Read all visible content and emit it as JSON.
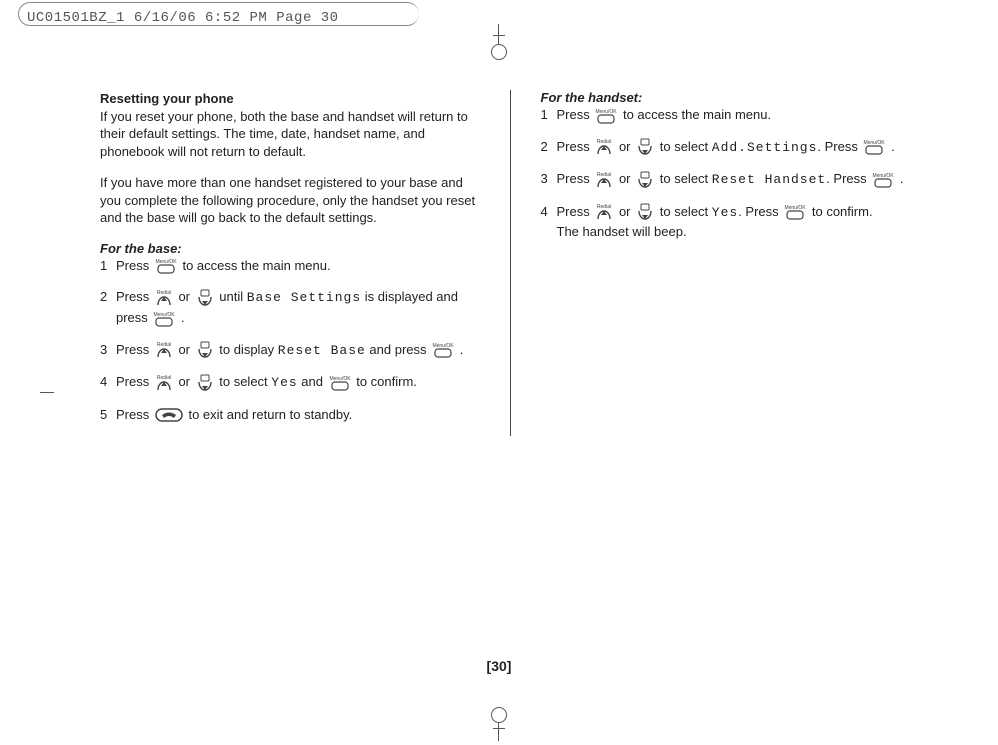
{
  "print_header": "UC01501BZ_1  6/16/06  6:52 PM  Page 30",
  "left": {
    "heading": "Resetting your phone",
    "para1": "If you reset your phone, both the base and handset will return to their default settings. The time, date, handset name, and phonebook will not return to default.",
    "para2": "If you have more than one handset registered to your base and you complete the following procedure, only the handset you reset and the base will go back to the default settings.",
    "subheading": "For the base:",
    "s1a": "Press ",
    "s1b": " to access the main menu.",
    "s2a": "Press ",
    "s2b": " or ",
    "s2c": " until ",
    "s2lcd": "Base Settings",
    "s2d": " is displayed and press ",
    "s2e": " .",
    "s3a": "Press ",
    "s3b": " or ",
    "s3c": " to display ",
    "s3lcd": "Reset Base",
    "s3d": " and press ",
    "s3e": " .",
    "s4a": "Press ",
    "s4b": " or ",
    "s4c": " to select ",
    "s4lcd": "Yes",
    "s4d": " and ",
    "s4e": " to confirm.",
    "s5a": "Press ",
    "s5b": " to exit and return to standby."
  },
  "right": {
    "subheading": "For the handset:",
    "s1a": "Press ",
    "s1b": " to access the main menu.",
    "s2a": "Press ",
    "s2b": " or ",
    "s2c": " to select ",
    "s2lcd": "Add.Settings",
    "s2d": ". Press ",
    "s2e": " .",
    "s3a": "Press ",
    "s3b": " or ",
    "s3c": " to select ",
    "s3lcd": "Reset Handset",
    "s3d": ". Press ",
    "s3e": " .",
    "s4a": "Press ",
    "s4b": " or ",
    "s4c": " to select ",
    "s4lcd": "Yes",
    "s4d": ". Press ",
    "s4e": " to confirm.",
    "s4f": "The handset will beep."
  },
  "page_number": "[30]",
  "nums": {
    "n1": "1",
    "n2": "2",
    "n3": "3",
    "n4": "4",
    "n5": "5"
  }
}
